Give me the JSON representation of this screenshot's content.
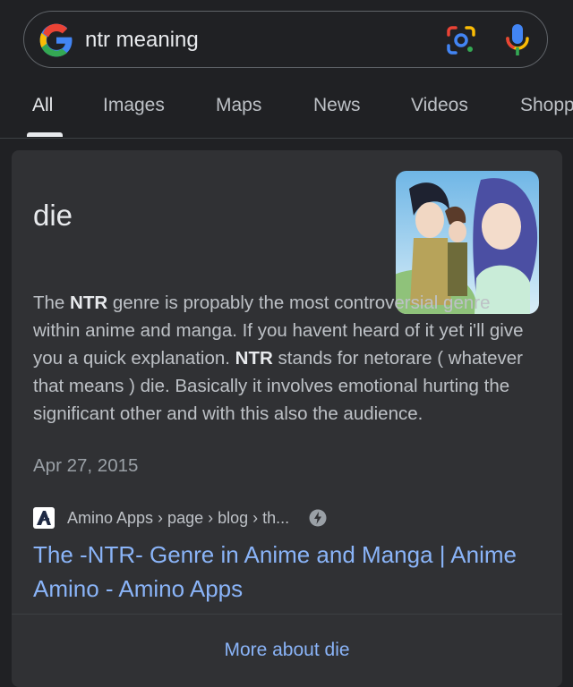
{
  "search": {
    "query": "ntr meaning"
  },
  "tabs": [
    {
      "label": "All",
      "active": true
    },
    {
      "label": "Images"
    },
    {
      "label": "Maps"
    },
    {
      "label": "News"
    },
    {
      "label": "Videos"
    },
    {
      "label": "Shopp"
    }
  ],
  "card": {
    "heading": "die",
    "snippet": {
      "part1": "The ",
      "bold1": "NTR",
      "part2": " genre is propably the most controversial genre within anime and manga. If you havent heard of it yet i'll give you a quick explanation. ",
      "bold2": "NTR",
      "part3": " stands for netorare ( whatever that means ) die. Basically it involves emotional hurting the significant other and with this also the audience."
    },
    "date": "Apr 27, 2015",
    "source": {
      "breadcrumb": "Amino Apps › page › blog › th...",
      "favicon_icon": "amino-logo-icon",
      "amp_icon": "amp-lightning-icon"
    },
    "result_title": "The -NTR- Genre in Anime and Manga | Anime Amino - Amino Apps",
    "more_link": "More about die"
  },
  "colors": {
    "background": "#202124",
    "card": "#303134",
    "link": "#8ab4f8",
    "text": "#e8eaed",
    "muted": "#bdc1c6"
  }
}
